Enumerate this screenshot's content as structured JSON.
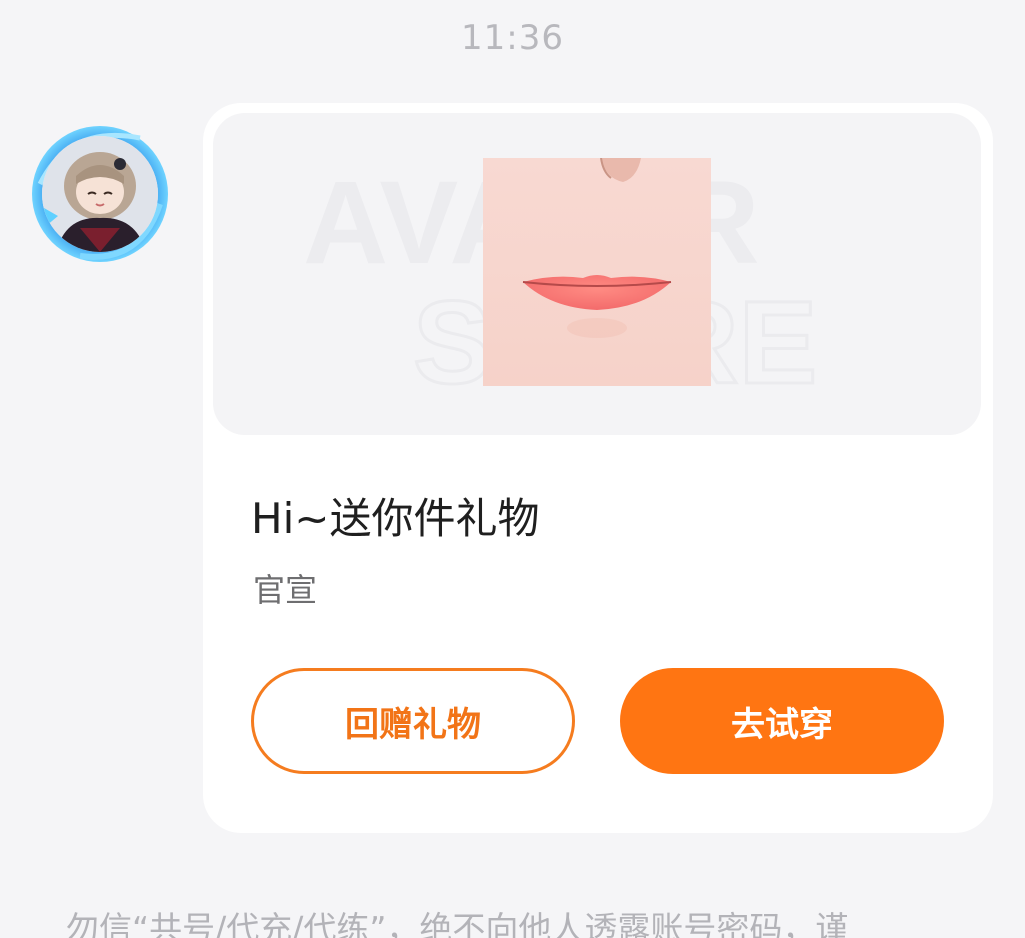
{
  "timestamp": "11:36",
  "sender": {
    "avatar_icon": "anime-character-avatar-icon"
  },
  "gift_card": {
    "banner": {
      "watermark_text_top": "AVATAR",
      "watermark_text_bottom": "STORE",
      "product_icon": "face-lips-item-icon"
    },
    "title": "Hi~送你件礼物",
    "subtitle": "官宣",
    "return_gift_label": "回赠礼物",
    "try_on_label": "去试穿"
  },
  "safety_notice": "勿信“共号/代充/代练”，绝不向他人透露账号密码，谨",
  "colors": {
    "accent": "#ff7512",
    "background": "#f5f5f7",
    "card": "#ffffff"
  }
}
